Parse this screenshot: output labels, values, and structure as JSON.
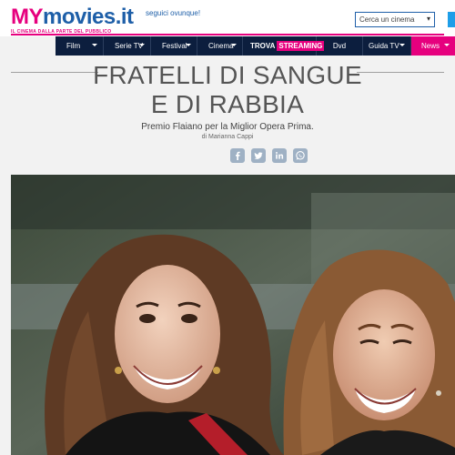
{
  "header": {
    "logo": {
      "my": "MY",
      "rest": "movies.it",
      "tagline": "IL CINEMA DALLA PARTE DEL PUBBLICO"
    },
    "follow_text": "seguici ovunque!",
    "cinema_search_label": "Cerca un cinema"
  },
  "nav": {
    "items": [
      {
        "label": "Film"
      },
      {
        "label": "Serie TV"
      },
      {
        "label": "Festival"
      },
      {
        "label": "Cinema"
      },
      {
        "label_a": "TROVA",
        "label_b": "STREAMING"
      },
      {
        "label": "Dvd"
      },
      {
        "label": "Guida TV"
      },
      {
        "label": "News"
      }
    ]
  },
  "article": {
    "title": "FRATELLI DI SANGUE E DI RABBIA",
    "subtitle": "Premio Flaiano per la Miglior Opera Prima.",
    "byline": "di Marianna Cappi"
  },
  "share": {
    "icons": [
      "facebook-icon",
      "twitter-icon",
      "linkedin-icon",
      "whatsapp-icon"
    ]
  },
  "colors": {
    "brand_pink": "#e6007e",
    "brand_blue": "#1e5fa8",
    "nav_bg": "#0c1e3e",
    "share_icon_bg": "#9fb1c4"
  }
}
